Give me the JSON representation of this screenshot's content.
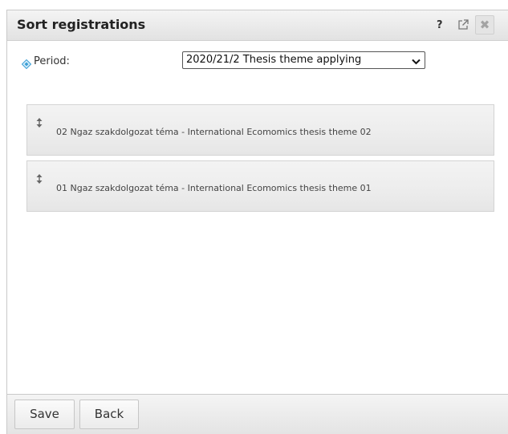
{
  "dialog": {
    "title": "Sort registrations",
    "help_label": "?",
    "close_label": "✖",
    "icons": {
      "popout": "popout-icon",
      "close": "close-icon",
      "period": "diamond-icon",
      "drag": "drag-handle-icon"
    }
  },
  "period": {
    "label": "Period:",
    "selected": "2020/21/2 Thesis theme applying"
  },
  "items": [
    {
      "label": "02 Ngaz szakdolgozat téma - International Ecomomics thesis theme 02"
    },
    {
      "label": "01 Ngaz szakdolgozat téma - International Ecomomics thesis theme 01"
    }
  ],
  "footer": {
    "save_label": "Save",
    "back_label": "Back"
  },
  "colors": {
    "accent": "#3a9fd6",
    "panel": "#ececec"
  }
}
